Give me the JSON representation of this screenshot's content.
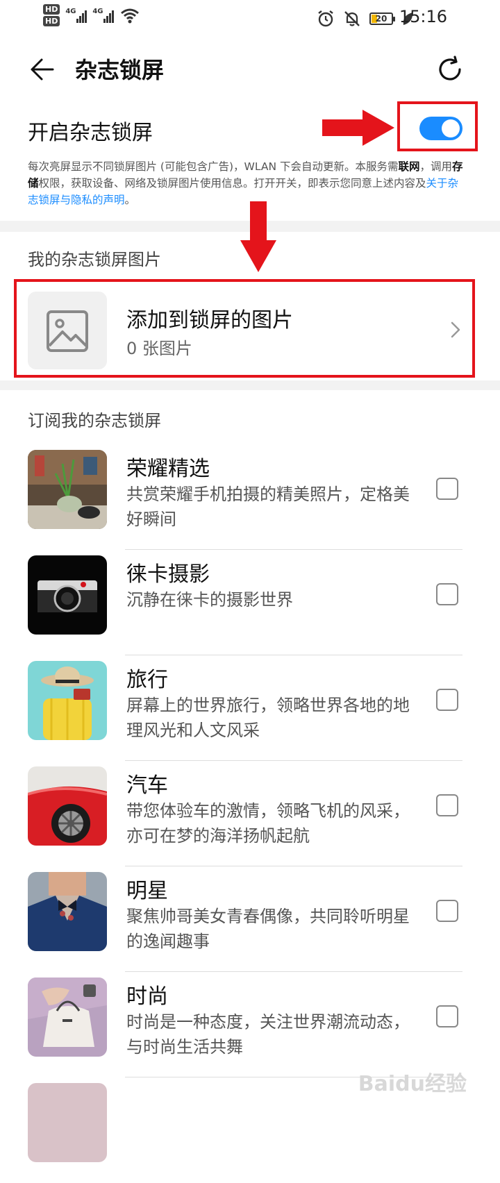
{
  "status_bar": {
    "hd1": "HD",
    "hd2": "HD",
    "net1": "4G",
    "net2": "4G",
    "battery": "20",
    "time": "15:16"
  },
  "header": {
    "title": "杂志锁屏"
  },
  "main_switch": {
    "label": "开启杂志锁屏",
    "on": true
  },
  "description": {
    "part1": "每次亮屏显示不同锁屏图片 (可能包含广告)，WLAN 下会自动更新。本服务需",
    "bold1": "联网",
    "part2": "，调用",
    "bold2": "存储",
    "part3": "权限，获取设备、网络及锁屏图片使用信息。打开开关，即表示您同意上述内容及",
    "link": "关于杂志锁屏与隐私的声明",
    "part4": "。"
  },
  "my_pictures": {
    "section_title": "我的杂志锁屏图片",
    "add_title": "添加到锁屏的图片",
    "add_count": "0 张图片"
  },
  "subscriptions": {
    "section_title": "订阅我的杂志锁屏",
    "items": [
      {
        "name": "荣耀精选",
        "desc": "共赏荣耀手机拍摄的精美照片，定格美好瞬间",
        "checked": false
      },
      {
        "name": "徕卡摄影",
        "desc": "沉静在徕卡的摄影世界",
        "checked": false
      },
      {
        "name": "旅行",
        "desc": "屏幕上的世界旅行，领略世界各地的地理风光和人文风采",
        "checked": false
      },
      {
        "name": "汽车",
        "desc": "带您体验车的激情，领略飞机的风采，亦可在梦的海洋扬帆起航",
        "checked": false
      },
      {
        "name": "明星",
        "desc": "聚焦帅哥美女青春偶像，共同聆听明星的逸闻趣事",
        "checked": false
      },
      {
        "name": "时尚",
        "desc": "时尚是一种态度，关注世界潮流动态，与时尚生活共舞",
        "checked": false
      }
    ]
  },
  "watermark": "Baidu经验",
  "colors": {
    "accent": "#1a8cff",
    "annotation": "#e4141b"
  }
}
